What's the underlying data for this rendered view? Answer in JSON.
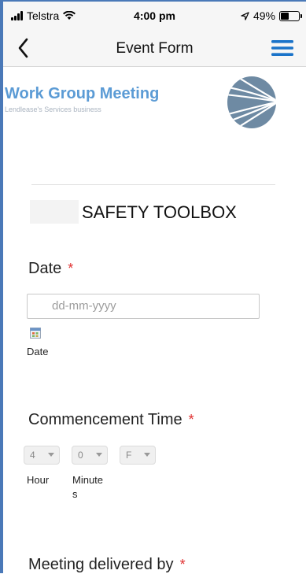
{
  "status_bar": {
    "carrier": "Telstra",
    "time": "4:00 pm",
    "battery": "49%",
    "battery_level": 0.49
  },
  "nav": {
    "title": "Event Form"
  },
  "header": {
    "logo_text": "Work Group Meeting",
    "logo_subtext": "Lendlease's Services business"
  },
  "section": {
    "title": "SAFETY TOOLBOX"
  },
  "date_field": {
    "label": "Date",
    "required_mark": "*",
    "placeholder": "dd-mm-yyyy",
    "icon_caption": "Date"
  },
  "commencement_field": {
    "label": "Commencement Time",
    "required_mark": "*",
    "hour_value": "4",
    "minute_value": "0",
    "ampm_value": "F",
    "hour_caption": "Hour",
    "minute_caption_line1": "Minute",
    "minute_caption_line2": "s"
  },
  "delivered_field": {
    "label": "Meeting delivered by",
    "required_mark": "*"
  },
  "colors": {
    "accent": "#1a73c9",
    "logo_blue": "#5b9bd5",
    "required": "#e03030",
    "frame": "#4a79b8"
  }
}
